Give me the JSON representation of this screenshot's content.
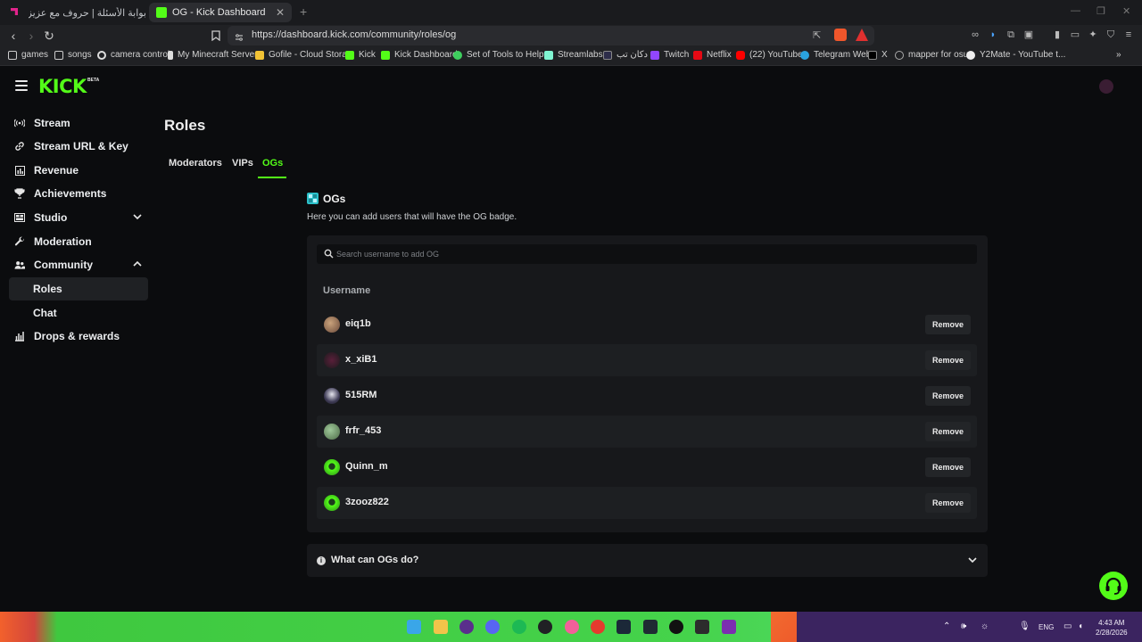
{
  "browser": {
    "tabs": [
      {
        "title": "بوابة الأسئلة | حروف مع عزيز",
        "active": false
      },
      {
        "title": "OG - Kick Dashboard",
        "active": true
      }
    ],
    "url": "https://dashboard.kick.com/community/roles/og",
    "bookmarks": [
      "games",
      "songs",
      "camera control",
      "My Minecraft Server",
      "Gofile - Cloud Stora...",
      "Kick",
      "Kick Dashboard",
      "Set of Tools to Help...",
      "Streamlabs",
      "دكان تب",
      "Twitch",
      "Netflix",
      "(22) YouTube",
      "Telegram Web",
      "X",
      "mapper for osu",
      "Y2Mate - YouTube t..."
    ]
  },
  "app": {
    "logo": "KICK",
    "beta": "BETA",
    "accent": "#53fc18"
  },
  "sidebar": {
    "items": [
      {
        "label": "Stream",
        "icon": "broadcast-icon"
      },
      {
        "label": "Stream URL & Key",
        "icon": "link-icon"
      },
      {
        "label": "Revenue",
        "icon": "chart-icon"
      },
      {
        "label": "Achievements",
        "icon": "trophy-icon"
      },
      {
        "label": "Studio",
        "icon": "studio-icon"
      },
      {
        "label": "Moderation",
        "icon": "wrench-icon"
      },
      {
        "label": "Community",
        "icon": "people-icon"
      },
      {
        "label": "Roles"
      },
      {
        "label": "Chat"
      },
      {
        "label": "Drops & rewards",
        "icon": "gift-icon"
      }
    ]
  },
  "main": {
    "title": "Roles",
    "tabs": [
      "Moderators",
      "VIPs",
      "OGs"
    ],
    "active_tab": "OGs",
    "section_title": "OGs",
    "section_description": "Here you can add users that will have the OG badge.",
    "search_placeholder": "Search username to add OG",
    "column_header": "Username",
    "remove_label": "Remove",
    "users": [
      "eiq1b",
      "x_xiB1",
      "515RM",
      "frfr_453",
      "Quinn_m",
      "3zooz822"
    ],
    "faq_question": "What can OGs do?"
  },
  "taskbar": {
    "language": "ENG",
    "time": "4:43 AM",
    "date": "2/28/2026"
  }
}
